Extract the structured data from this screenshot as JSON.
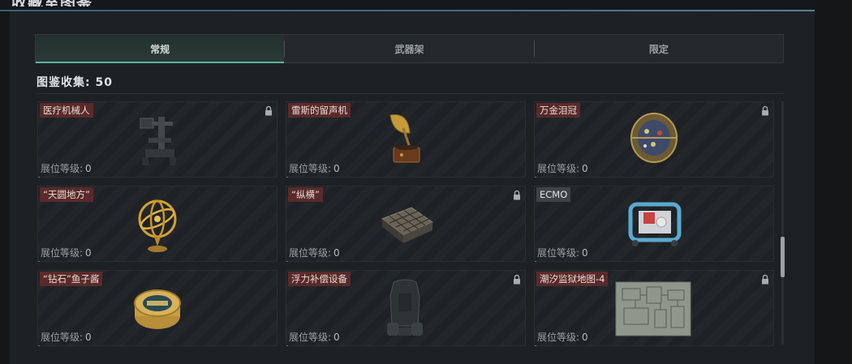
{
  "header": {
    "title": "收藏室图鉴"
  },
  "tabs": [
    {
      "label": "常规",
      "active": true
    },
    {
      "label": "武器架",
      "active": false
    },
    {
      "label": "限定",
      "active": false
    }
  ],
  "collection": {
    "label": "图鉴收集:",
    "count": "50"
  },
  "level_label": "展位等级:",
  "items": [
    {
      "name": "医疗机械人",
      "level": "0",
      "locked": true,
      "icon": "medical-robot-icon"
    },
    {
      "name": "雷斯的留声机",
      "level": "0",
      "locked": false,
      "icon": "gramophone-icon"
    },
    {
      "name": "万金泪冠",
      "level": "0",
      "locked": true,
      "icon": "jeweled-crown-icon"
    },
    {
      "name": "“天圆地方”",
      "level": "0",
      "locked": false,
      "icon": "armillary-sphere-icon"
    },
    {
      "name": "“纵横”",
      "level": "0",
      "locked": true,
      "icon": "chess-board-icon"
    },
    {
      "name": "ECMO",
      "level": "0",
      "locked": false,
      "icon": "ecmo-machine-icon"
    },
    {
      "name": "“钻石”鱼子酱",
      "level": "0",
      "locked": false,
      "icon": "caviar-tin-icon"
    },
    {
      "name": "浮力补偿设备",
      "level": "0",
      "locked": true,
      "icon": "buoyancy-vest-icon"
    },
    {
      "name": "潮汐监狱地图-4",
      "level": "0",
      "locked": true,
      "icon": "prison-map-icon"
    }
  ]
}
